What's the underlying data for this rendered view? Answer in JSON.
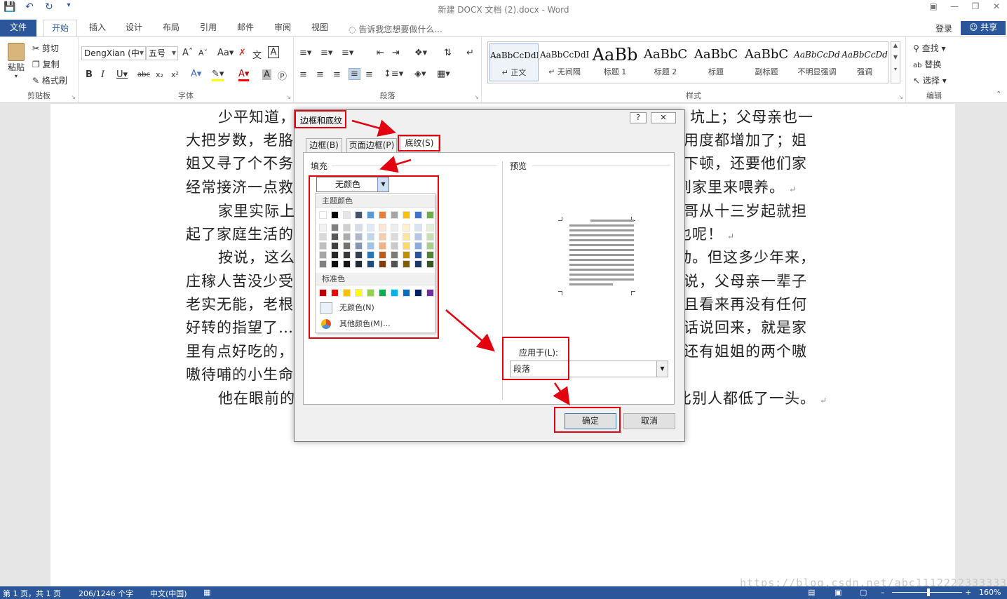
{
  "window": {
    "title": "新建 DOCX 文档 (2).docx - Word"
  },
  "ribbon_tabs": {
    "file": "文件",
    "home": "开始",
    "insert": "插入",
    "design": "设计",
    "layout": "布局",
    "references": "引用",
    "mailings": "邮件",
    "review": "审阅",
    "view": "视图",
    "tell_me": "告诉我您想要做什么...",
    "login": "登录",
    "share": "共享"
  },
  "clipboard": {
    "paste": "粘贴",
    "cut": "剪切",
    "copy": "复制",
    "format_painter": "格式刷",
    "label": "剪贴板"
  },
  "font": {
    "name": "DengXian (中",
    "size": "五号",
    "label": "字体"
  },
  "paragraph": {
    "label": "段落"
  },
  "styles": {
    "label": "样式",
    "items": [
      {
        "sample": "AaBbCcDdI",
        "name": "↵ 正文"
      },
      {
        "sample": "AaBbCcDdI",
        "name": "↵ 无间隔"
      },
      {
        "sample": "AaBb",
        "name": "标题 1"
      },
      {
        "sample": "AaBbC",
        "name": "标题 2"
      },
      {
        "sample": "AaBbC",
        "name": "标题"
      },
      {
        "sample": "AaBbC",
        "name": "副标题"
      },
      {
        "sample": "AaBbCcDd",
        "name": "不明显强调"
      },
      {
        "sample": "AaBbCcDd",
        "name": "强调"
      }
    ]
  },
  "editing": {
    "find": "查找",
    "replace": "替换",
    "select": "选择",
    "label": "编辑"
  },
  "document": {
    "lines_left": [
      "少平知道，",
      "大把岁数，老胳",
      "姐又寻了个不务",
      "经常接济一点救",
      "家里实际上",
      "起了家庭生活的",
      "按说，这么",
      "庄稼人苦没少受",
      "老实无能，老根",
      "好转的指望了…",
      "里有点好吃的，",
      "嗷待哺的小生命",
      "他在眼前的"
    ],
    "lines_right": [
      "坑上；父母亲也一",
      "用度都增加了；姐",
      "下顿，还要他们家",
      "到家里来喂养。",
      "哥从十三岁起就担",
      "也呢！",
      "动。但这多少年来，",
      "说，父母亲一辈子",
      "且看来再没有任何",
      "话说回来，就是家",
      "还有姐姐的两个嗷",
      "",
      "比别人都低了一头。"
    ]
  },
  "dialog": {
    "title": "边框和底纹",
    "help": "?",
    "close": "✕",
    "tabs": [
      "边框(B)",
      "页面边框(P)",
      "底纹(S)"
    ],
    "fill_label": "填充",
    "fill_value": "无颜色",
    "preview_label": "预览",
    "apply_label": "应用于(L):",
    "apply_value": "段落",
    "ok": "确定",
    "cancel": "取消",
    "palette": {
      "theme_label": "主题颜色",
      "standard_label": "标准色",
      "no_color": "无颜色(N)",
      "more_colors": "其他颜色(M)...",
      "theme_top": [
        "#ffffff",
        "#000000",
        "#e7e6e6",
        "#44546a",
        "#5b9bd5",
        "#ed7d31",
        "#a5a5a5",
        "#ffc000",
        "#4472c4",
        "#70ad47"
      ],
      "theme_shades": [
        [
          "#f2f2f2",
          "#d9d9d9",
          "#bfbfbf",
          "#a6a6a6",
          "#808080"
        ],
        [
          "#808080",
          "#595959",
          "#404040",
          "#262626",
          "#0d0d0d"
        ],
        [
          "#d0cece",
          "#aeabab",
          "#757171",
          "#3a3838",
          "#171616"
        ],
        [
          "#d6dce4",
          "#adb9ca",
          "#8497b0",
          "#333f4f",
          "#222a35"
        ],
        [
          "#deebf6",
          "#bdd7ee",
          "#9dc3e6",
          "#2e75b5",
          "#1e4e79"
        ],
        [
          "#fbe5d5",
          "#f7cbac",
          "#f4b183",
          "#c55a11",
          "#833c0b"
        ],
        [
          "#ededed",
          "#dbdbdb",
          "#c9c9c9",
          "#7b7b7b",
          "#525252"
        ],
        [
          "#fff2cc",
          "#fee599",
          "#ffd966",
          "#bf9000",
          "#7f6000"
        ],
        [
          "#dae3f3",
          "#b4c7e7",
          "#8eaadb",
          "#2f5496",
          "#1f3864"
        ],
        [
          "#e2efd9",
          "#c5e0b3",
          "#a8d08d",
          "#538135",
          "#375623"
        ]
      ],
      "standard": [
        "#c00000",
        "#ff0000",
        "#ffc000",
        "#ffff00",
        "#92d050",
        "#00b050",
        "#00b0f0",
        "#0070c0",
        "#002060",
        "#7030a0"
      ]
    }
  },
  "status_bar": {
    "page": "第 1 页，共 1 页",
    "words": "206/1246 个字",
    "language": "中文(中国)",
    "zoom": "160%"
  },
  "watermark": "https://blog.csdn.net/abc1112222333333",
  "colors": {
    "accent": "#2b579a",
    "annotation": "#e3000f"
  }
}
